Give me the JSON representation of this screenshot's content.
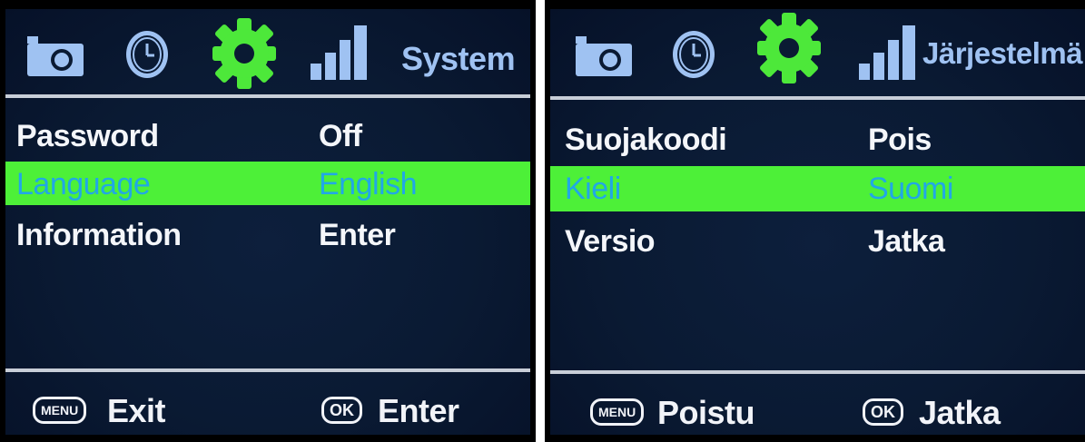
{
  "colors": {
    "background": "#0a1a33",
    "highlight": "#4df038",
    "highlight_text": "#21a7e6",
    "icon_blue": "#9fc2f2",
    "gear_active": "#4de83a",
    "text": "#f4f6fa"
  },
  "screens": [
    {
      "icons": [
        "camera-icon",
        "clock-icon",
        "gear-icon",
        "signal-icon"
      ],
      "active_tab": "gear-icon",
      "tab_title": "System",
      "rows": [
        {
          "label": "Password",
          "value": "Off",
          "selected": false
        },
        {
          "label": "Language",
          "value": "English",
          "selected": true
        },
        {
          "label": "Information",
          "value": "Enter",
          "selected": false
        }
      ],
      "footer": {
        "menu_badge": "MENU",
        "menu_label": "Exit",
        "ok_badge": "OK",
        "ok_label": "Enter"
      }
    },
    {
      "icons": [
        "camera-icon",
        "clock-icon",
        "gear-icon",
        "signal-icon"
      ],
      "active_tab": "gear-icon",
      "tab_title": "Järjestelmä",
      "rows": [
        {
          "label": "Suojakoodi",
          "value": "Pois",
          "selected": false
        },
        {
          "label": "Kieli",
          "value": "Suomi",
          "selected": true
        },
        {
          "label": "Versio",
          "value": "Jatka",
          "selected": false
        }
      ],
      "footer": {
        "menu_badge": "MENU",
        "menu_label": "Poistu",
        "ok_badge": "OK",
        "ok_label": "Jatka"
      }
    }
  ]
}
